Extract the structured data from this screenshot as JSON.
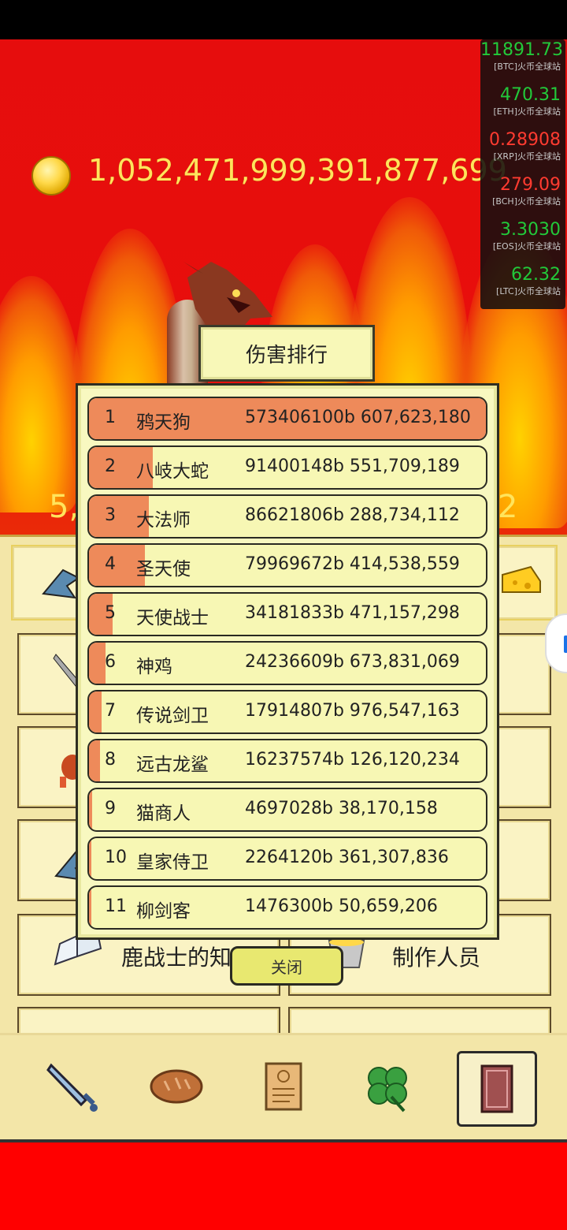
{
  "gold": "1,052,471,999,391,877,699",
  "side_left": "5,",
  "side_right": "2",
  "ticker": [
    {
      "price": "11891.73",
      "label": "[BTC]火币全球站",
      "color": "up"
    },
    {
      "price": "470.31",
      "label": "[ETH]火币全球站",
      "color": "up"
    },
    {
      "price": "0.28908",
      "label": "[XRP]火币全球站",
      "color": "down"
    },
    {
      "price": "279.09",
      "label": "[BCH]火币全球站",
      "color": "down"
    },
    {
      "price": "3.3030",
      "label": "[EOS]火币全球站",
      "color": "up"
    },
    {
      "price": "62.32",
      "label": "[LTC]火币全球站",
      "color": "up"
    }
  ],
  "popup": {
    "title": "伤害排行",
    "close": "关闭",
    "rows": [
      {
        "rank": "1",
        "name": "鸦天狗",
        "score": "573406100b 607,623,180",
        "fill": 1.0
      },
      {
        "rank": "2",
        "name": "八岐大蛇",
        "score": "91400148b 551,709,189",
        "fill": 0.16
      },
      {
        "rank": "3",
        "name": "大法师",
        "score": "86621806b 288,734,112",
        "fill": 0.15
      },
      {
        "rank": "4",
        "name": "圣天使",
        "score": "79969672b 414,538,559",
        "fill": 0.14
      },
      {
        "rank": "5",
        "name": "天使战士",
        "score": "34181833b 471,157,298",
        "fill": 0.06
      },
      {
        "rank": "6",
        "name": "神鸡",
        "score": "24236609b 673,831,069",
        "fill": 0.042
      },
      {
        "rank": "7",
        "name": "传说剑卫",
        "score": "17914807b 976,547,163",
        "fill": 0.031
      },
      {
        "rank": "8",
        "name": "远古龙鲨",
        "score": "16237574b 126,120,234",
        "fill": 0.028
      },
      {
        "rank": "9",
        "name": "猫商人",
        "score": "4697028b 38,170,158",
        "fill": 0.008
      },
      {
        "rank": "10",
        "name": "皇家侍卫",
        "score": "2264120b 361,307,836",
        "fill": 0.004
      },
      {
        "rank": "11",
        "name": "柳剑客",
        "score": "1476300b 50,659,206",
        "fill": 0.0026
      }
    ]
  },
  "menu": {
    "knowledge": "鹿战士的知识",
    "credits": "制作人员"
  },
  "nav": [
    "sword",
    "bread",
    "scroll",
    "clover",
    "book"
  ]
}
